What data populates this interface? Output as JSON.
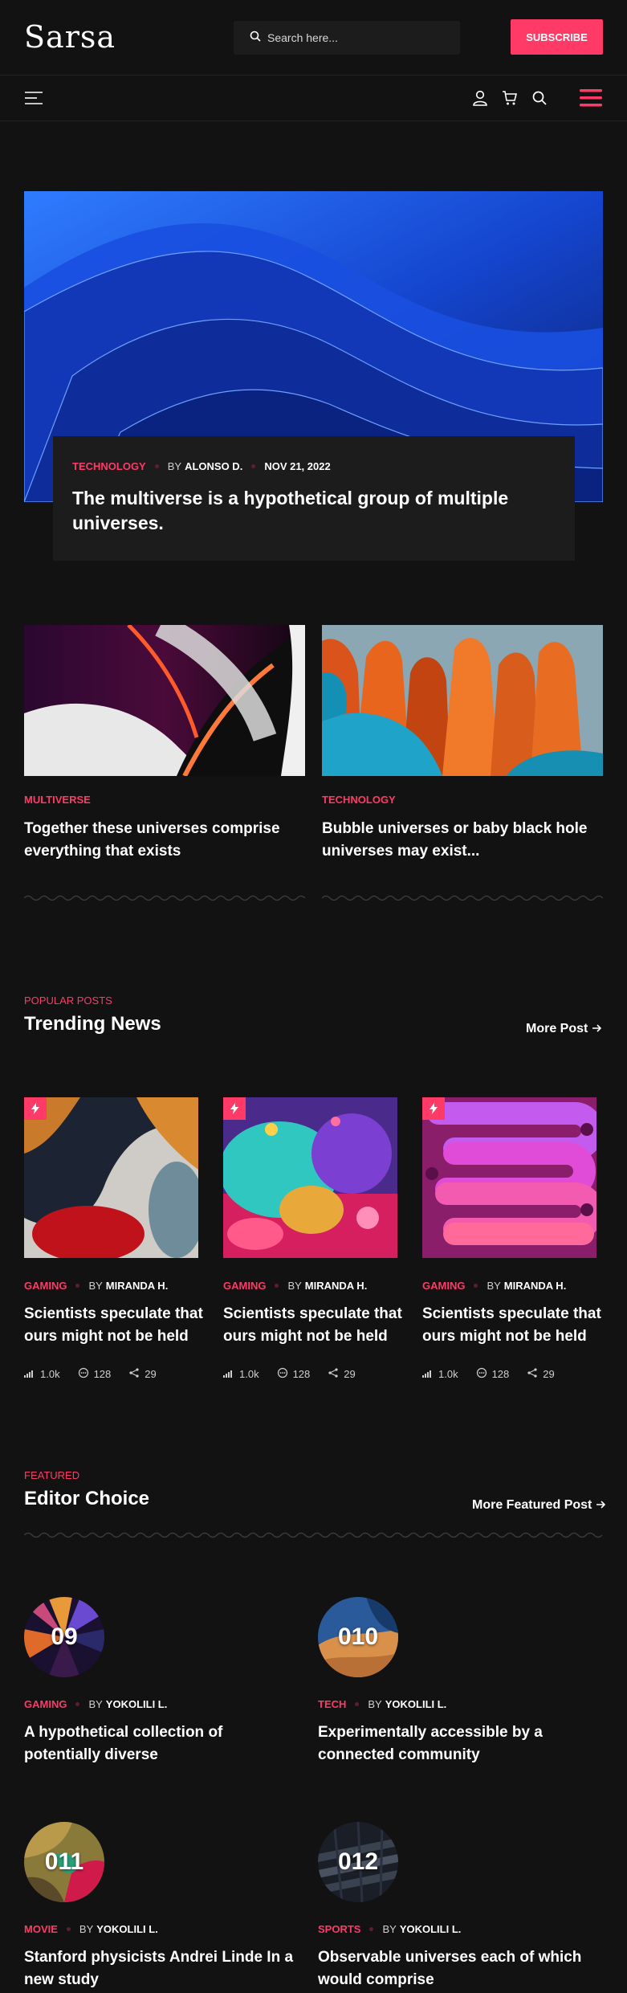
{
  "header": {
    "logo": "Sarsa",
    "search_placeholder": "Search here...",
    "subscribe_label": "SUBSCRIBE"
  },
  "hero": {
    "category": "TECHNOLOGY",
    "by": "BY",
    "author": "ALONSO D.",
    "date": "NOV 21, 2022",
    "title": "The multiverse is a hypothetical group of multiple universes."
  },
  "posts": [
    {
      "category": "MULTIVERSE",
      "title": "Together these universes comprise everything that exists"
    },
    {
      "category": "TECHNOLOGY",
      "title": "Bubble universes or baby black hole universes may exist..."
    }
  ],
  "trending": {
    "kicker": "POPULAR POSTS",
    "title": "Trending News",
    "more_label": "More Post",
    "items": [
      {
        "category": "GAMING",
        "by": "BY",
        "author": "MIRANDA H.",
        "title": "Scientists speculate that ours might not be held",
        "views": "1.0k",
        "comments": "128",
        "shares": "29"
      },
      {
        "category": "GAMING",
        "by": "BY",
        "author": "MIRANDA H.",
        "title": "Scientists speculate that ours might not be held",
        "views": "1.0k",
        "comments": "128",
        "shares": "29"
      },
      {
        "category": "GAMING",
        "by": "BY",
        "author": "MIRANDA H.",
        "title": "Scientists speculate that ours might not be held",
        "views": "1.0k",
        "comments": "128",
        "shares": "29"
      }
    ]
  },
  "editor": {
    "kicker": "FEATURED",
    "title": "Editor Choice",
    "more_label": "More Featured Post",
    "items": [
      {
        "number": "09",
        "category": "GAMING",
        "by": "BY",
        "author": "YOKOLILI L.",
        "title": "A hypothetical collection of potentially diverse"
      },
      {
        "number": "010",
        "category": "TECH",
        "by": "BY",
        "author": "YOKOLILI L.",
        "title": "Experimentally accessible by a connected community"
      },
      {
        "number": "011",
        "category": "MOVIE",
        "by": "BY",
        "author": "YOKOLILI L.",
        "title": "Stanford physicists Andrei Linde In a new study"
      },
      {
        "number": "012",
        "category": "SPORTS",
        "by": "BY",
        "author": "YOKOLILI L.",
        "title": "Observable universes each of which would comprise"
      }
    ]
  },
  "colors": {
    "accent": "#ff3a67",
    "background": "#121212",
    "card": "#1c1c1c"
  },
  "icons": [
    "search-icon",
    "menu-icon",
    "user-icon",
    "cart-icon",
    "hamburger-icon",
    "arrow-right-icon",
    "bolt-icon",
    "views-icon",
    "comments-icon",
    "share-icon"
  ]
}
